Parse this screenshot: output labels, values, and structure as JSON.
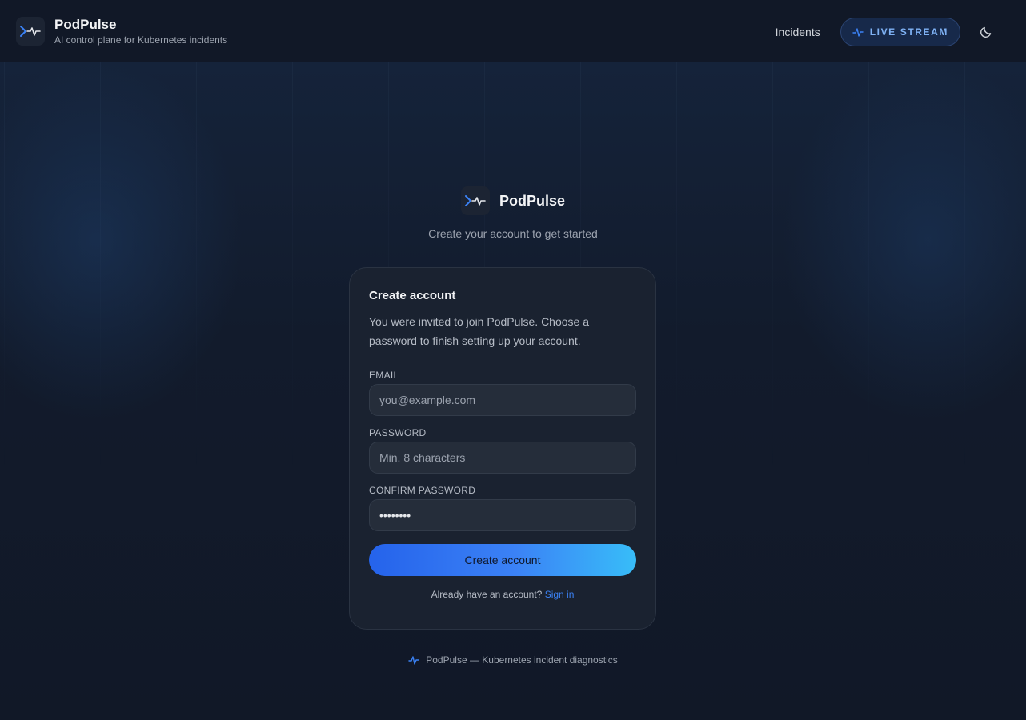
{
  "header": {
    "title": "PodPulse",
    "subtitle": "AI control plane for Kubernetes incidents",
    "nav": {
      "incidents": "Incidents",
      "live_stream": "LIVE STREAM"
    }
  },
  "hero": {
    "title": "PodPulse",
    "subtitle": "Create your account to get started"
  },
  "form": {
    "title": "Create account",
    "description": "You were invited to join PodPulse. Choose a password to finish setting up your account.",
    "email_label": "EMAIL",
    "email_placeholder": "you@example.com",
    "password_label": "PASSWORD",
    "password_placeholder": "Min. 8 characters",
    "confirm_label": "CONFIRM PASSWORD",
    "confirm_value": "••••••••",
    "submit_label": "Create account",
    "signin_prompt": "Already have an account?",
    "signin_link": "Sign in"
  },
  "footer": {
    "text": "PodPulse — Kubernetes incident diagnostics"
  },
  "icons": {
    "logo": "pulse-chevron-icon",
    "live": "activity-icon",
    "theme": "moon-icon"
  },
  "colors": {
    "accent": "#3b82f6",
    "accent_light": "#38bdf8",
    "background": "#111827",
    "card": "#1a2230"
  }
}
